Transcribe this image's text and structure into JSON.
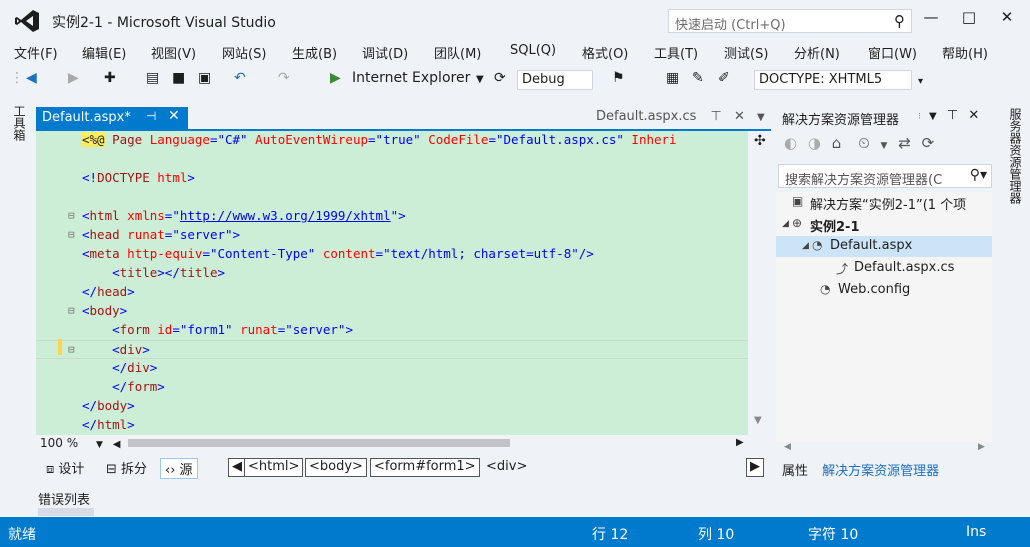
{
  "title_bar": {
    "title": "实例2-1 - Microsoft Visual Studio",
    "quick_launch_placeholder": "快速启动 (Ctrl+Q)",
    "minimize": "—",
    "maximize": "□",
    "close": "✕"
  },
  "menu": [
    "文件(F)",
    "编辑(E)",
    "视图(V)",
    "网站(S)",
    "生成(B)",
    "调试(D)",
    "团队(M)",
    "SQL(Q)",
    "格式(O)",
    "工具(T)",
    "测试(S)",
    "分析(N)",
    "窗口(W)",
    "帮助(H)"
  ],
  "toolbar": {
    "browser": "Internet Explorer",
    "config": "Debug",
    "doctype": "DOCTYPE: XHTML5"
  },
  "toolbox_label": "工具箱",
  "tabs": {
    "active": "Default.aspx*",
    "inactive": "Default.aspx.cs"
  },
  "code_lines": [
    {
      "id": "l1",
      "parts": [
        [
          "dir",
          "<%@"
        ],
        [
          "tag",
          " Page "
        ],
        [
          "attr",
          "Language"
        ],
        [
          "br",
          "="
        ],
        [
          "val",
          "\"C#\""
        ],
        [
          "attr",
          " AutoEventWireup"
        ],
        [
          "br",
          "="
        ],
        [
          "val",
          "\"true\""
        ],
        [
          "attr",
          " CodeFile"
        ],
        [
          "br",
          "="
        ],
        [
          "val",
          "\"Default.aspx.cs\""
        ],
        [
          "attr",
          " Inheri"
        ]
      ]
    },
    {
      "id": "l2",
      "parts": []
    },
    {
      "id": "l3",
      "parts": [
        [
          "br",
          "<!"
        ],
        [
          "tag",
          "DOCTYPE"
        ],
        [
          "attr",
          " html"
        ],
        [
          "br",
          ">"
        ]
      ]
    },
    {
      "id": "l4",
      "parts": []
    },
    {
      "id": "l5",
      "parts": [
        [
          "br",
          "<"
        ],
        [
          "tag",
          "html"
        ],
        [
          "attr",
          " xmlns"
        ],
        [
          "br",
          "=\""
        ],
        [
          "url",
          "http://www.w3.org/1999/xhtml"
        ],
        [
          "br",
          "\">"
        ]
      ]
    },
    {
      "id": "l6",
      "parts": [
        [
          "br",
          "<"
        ],
        [
          "tag",
          "head"
        ],
        [
          "attr",
          " runat"
        ],
        [
          "br",
          "="
        ],
        [
          "val",
          "\"server\""
        ],
        [
          "br",
          ">"
        ]
      ]
    },
    {
      "id": "l7",
      "parts": [
        [
          "br",
          "<"
        ],
        [
          "tag",
          "meta"
        ],
        [
          "attr",
          " http-equiv"
        ],
        [
          "br",
          "="
        ],
        [
          "val",
          "\"Content-Type\""
        ],
        [
          "attr",
          " content"
        ],
        [
          "br",
          "="
        ],
        [
          "val",
          "\"text/html; charset=utf-8\""
        ],
        [
          "br",
          "/>"
        ]
      ]
    },
    {
      "id": "l8",
      "parts": [
        [
          "tag",
          "    "
        ],
        [
          "br",
          "<"
        ],
        [
          "tag",
          "title"
        ],
        [
          "br",
          "></"
        ],
        [
          "tag",
          "title"
        ],
        [
          "br",
          ">"
        ]
      ]
    },
    {
      "id": "l9",
      "parts": [
        [
          "br",
          "</"
        ],
        [
          "tag",
          "head"
        ],
        [
          "br",
          ">"
        ]
      ]
    },
    {
      "id": "l10",
      "parts": [
        [
          "br",
          "<"
        ],
        [
          "tag",
          "body"
        ],
        [
          "br",
          ">"
        ]
      ]
    },
    {
      "id": "l11",
      "parts": [
        [
          "tag",
          "    "
        ],
        [
          "br",
          "<"
        ],
        [
          "tag",
          "form"
        ],
        [
          "attr",
          " id"
        ],
        [
          "br",
          "="
        ],
        [
          "val",
          "\"form1\""
        ],
        [
          "attr",
          " runat"
        ],
        [
          "br",
          "="
        ],
        [
          "val",
          "\"server\""
        ],
        [
          "br",
          ">"
        ]
      ]
    },
    {
      "id": "l12",
      "parts": [
        [
          "tag",
          "    "
        ],
        [
          "br",
          "<"
        ],
        [
          "tag",
          "div"
        ],
        [
          "br",
          ">"
        ]
      ]
    },
    {
      "id": "l13",
      "parts": [
        [
          "tag",
          "    "
        ],
        [
          "br",
          "</"
        ],
        [
          "tag",
          "div"
        ],
        [
          "br",
          ">"
        ]
      ]
    },
    {
      "id": "l14",
      "parts": [
        [
          "tag",
          "    "
        ],
        [
          "br",
          "</"
        ],
        [
          "tag",
          "form"
        ],
        [
          "br",
          ">"
        ]
      ]
    },
    {
      "id": "l15",
      "parts": [
        [
          "br",
          "</"
        ],
        [
          "tag",
          "body"
        ],
        [
          "br",
          ">"
        ]
      ]
    },
    {
      "id": "l16",
      "parts": [
        [
          "br",
          "</"
        ],
        [
          "tag",
          "html"
        ],
        [
          "br",
          ">"
        ]
      ]
    }
  ],
  "gutter_marks": [
    "",
    "",
    "",
    "",
    "⊟",
    "⊟",
    "",
    "",
    "",
    "⊟",
    "",
    "⊟",
    "",
    "",
    "",
    ""
  ],
  "zoom": "100 %",
  "view_bar": {
    "design": "设计",
    "split": "拆分",
    "source": "源",
    "crumbs": [
      "<html>",
      "<body>",
      "<form#form1>",
      "<div>"
    ]
  },
  "error_list": "错误列表",
  "solution_explorer": {
    "title": "解决方案资源管理器",
    "search_placeholder": "搜索解决方案资源管理器(C",
    "tree": [
      {
        "label": "解决方案“实例2-1”(1 个项",
        "icon": "▣",
        "expander": ""
      },
      {
        "label": "实例2-1",
        "icon": "⊕",
        "expander": "◢"
      },
      {
        "label": "Default.aspx",
        "icon": "◔",
        "expander": "◢"
      },
      {
        "label": "Default.aspx.cs",
        "icon": "⤴",
        "expander": ""
      },
      {
        "label": "Web.config",
        "icon": "◔",
        "expander": ""
      }
    ],
    "bottom_tabs": [
      "属性",
      "解决方案资源管理器"
    ]
  },
  "right_vertical_tab": "服务器资源管理器",
  "status_bar": {
    "ready": "就绪",
    "line": "行 12",
    "col": "列 10",
    "char": "字符 10",
    "ins": "Ins"
  },
  "colors": {
    "accent": "#007acc",
    "editor_bg": "#cceed6"
  }
}
